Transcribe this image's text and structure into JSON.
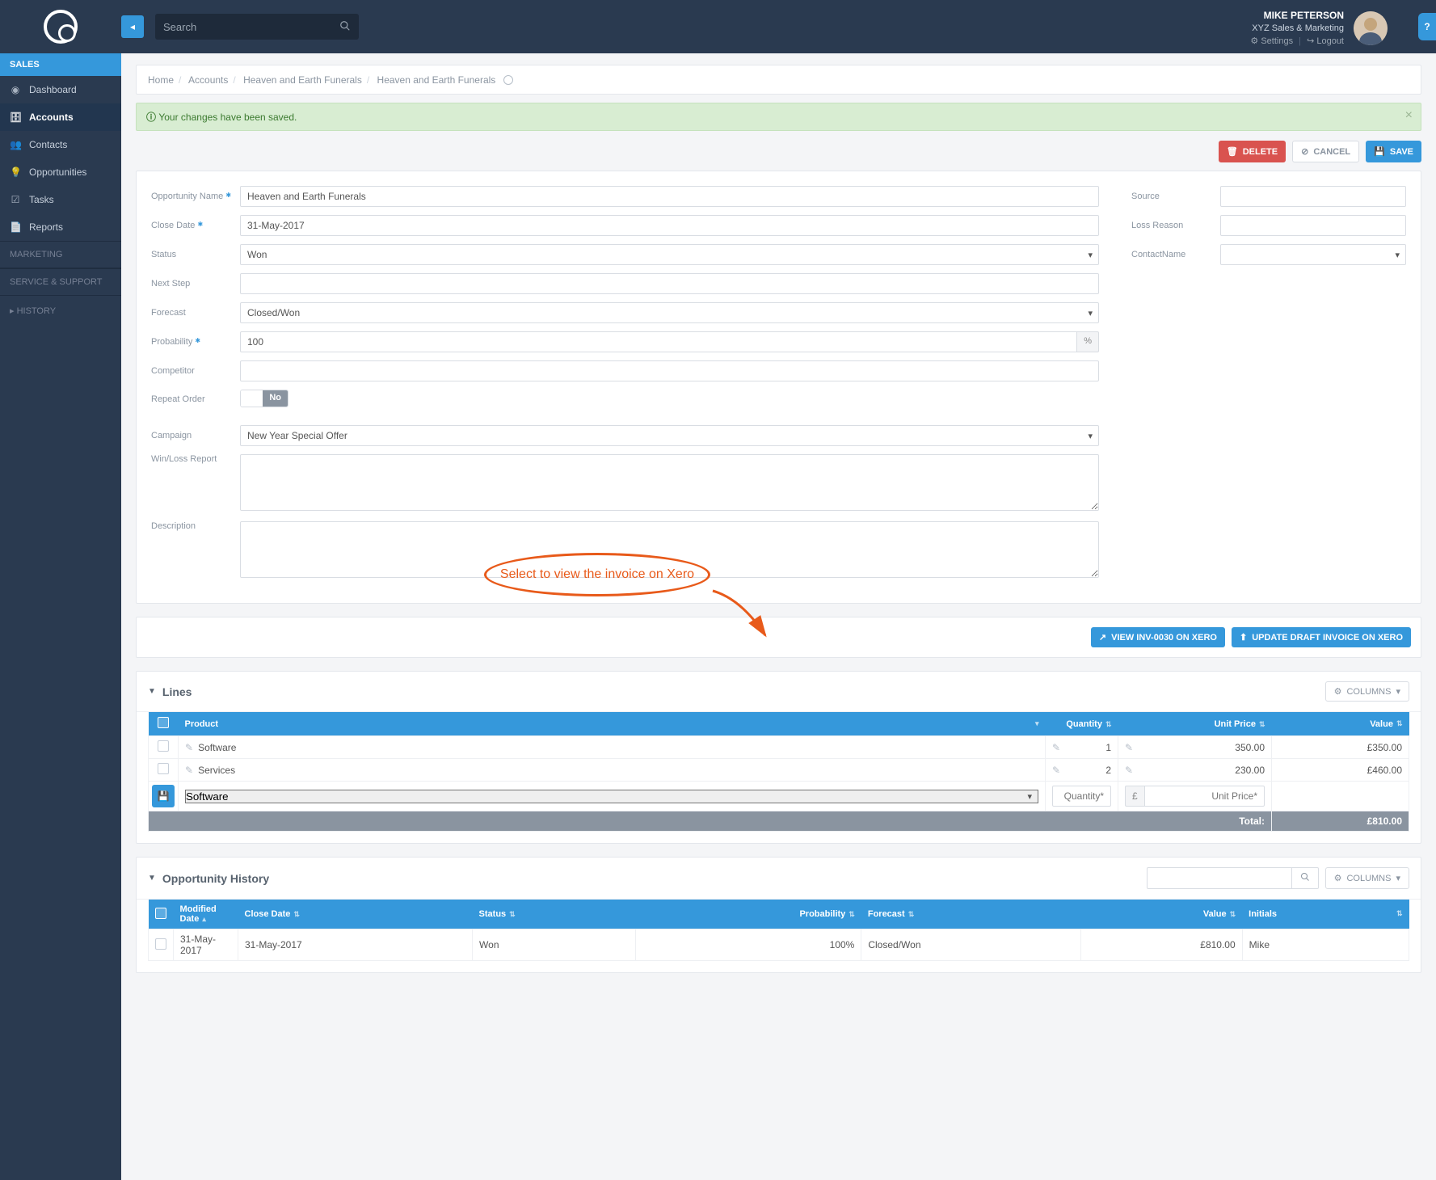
{
  "topbar": {
    "search_placeholder": "Search",
    "user_name": "MIKE PETERSON",
    "user_org": "XYZ Sales & Marketing",
    "settings_label": "Settings",
    "logout_label": "Logout",
    "help_label": "?"
  },
  "sidebar": {
    "sales_header": "SALES",
    "items": [
      {
        "icon": "◉",
        "label": "Dashboard"
      },
      {
        "icon": "🗄",
        "label": "Accounts",
        "active": true
      },
      {
        "icon": "👥",
        "label": "Contacts"
      },
      {
        "icon": "💡",
        "label": "Opportunities"
      },
      {
        "icon": "☑",
        "label": "Tasks"
      },
      {
        "icon": "📄",
        "label": "Reports"
      }
    ],
    "marketing_header": "MARKETING",
    "service_header": "SERVICE & SUPPORT",
    "history_label": "HISTORY"
  },
  "breadcrumb": {
    "home": "Home",
    "accounts": "Accounts",
    "parent": "Heaven and Earth Funerals",
    "current": "Heaven and Earth Funerals"
  },
  "alert": {
    "message": "Your changes have been saved."
  },
  "actions": {
    "delete": "DELETE",
    "cancel": "CANCEL",
    "save": "SAVE"
  },
  "form": {
    "labels": {
      "opportunity_name": "Opportunity Name",
      "close_date": "Close Date",
      "status": "Status",
      "next_step": "Next Step",
      "forecast": "Forecast",
      "probability": "Probability",
      "competitor": "Competitor",
      "repeat_order": "Repeat Order",
      "campaign": "Campaign",
      "winloss": "Win/Loss Report",
      "description": "Description",
      "source": "Source",
      "loss_reason": "Loss Reason",
      "contact_name": "ContactName"
    },
    "values": {
      "opportunity_name": "Heaven and Earth Funerals",
      "close_date": "31-May-2017",
      "status": "Won",
      "next_step": "",
      "forecast": "Closed/Won",
      "probability": "100",
      "competitor": "",
      "repeat_order": "No",
      "campaign": "New Year Special Offer",
      "winloss": "",
      "description": "",
      "source": "",
      "loss_reason": "",
      "contact_name": ""
    },
    "pct": "%"
  },
  "xero": {
    "view": "VIEW INV-0030 ON XERO",
    "update": "UPDATE DRAFT INVOICE ON XERO"
  },
  "lines": {
    "title": "Lines",
    "columns_btn": "COLUMNS",
    "headers": {
      "product": "Product",
      "quantity": "Quantity",
      "unit_price": "Unit Price",
      "value": "Value"
    },
    "rows": [
      {
        "product": "Software",
        "quantity": "1",
        "unit_price": "350.00",
        "value": "£350.00"
      },
      {
        "product": "Services",
        "quantity": "2",
        "unit_price": "230.00",
        "value": "£460.00"
      }
    ],
    "add": {
      "product_option": "Software",
      "qty_placeholder": "Quantity*",
      "currency": "£",
      "unit_placeholder": "Unit Price*"
    },
    "total_label": "Total:",
    "total_value": "£810.00"
  },
  "history": {
    "title": "Opportunity History",
    "columns_btn": "COLUMNS",
    "headers": {
      "modified": "Modified Date",
      "close": "Close Date",
      "status": "Status",
      "probability": "Probability",
      "forecast": "Forecast",
      "value": "Value",
      "initials": "Initials"
    },
    "rows": [
      {
        "modified": "31-May-2017",
        "close": "31-May-2017",
        "status": "Won",
        "probability": "100%",
        "forecast": "Closed/Won",
        "value": "£810.00",
        "initials": "Mike"
      }
    ]
  },
  "annotation": {
    "text": "Select to view the invoice on Xero"
  }
}
